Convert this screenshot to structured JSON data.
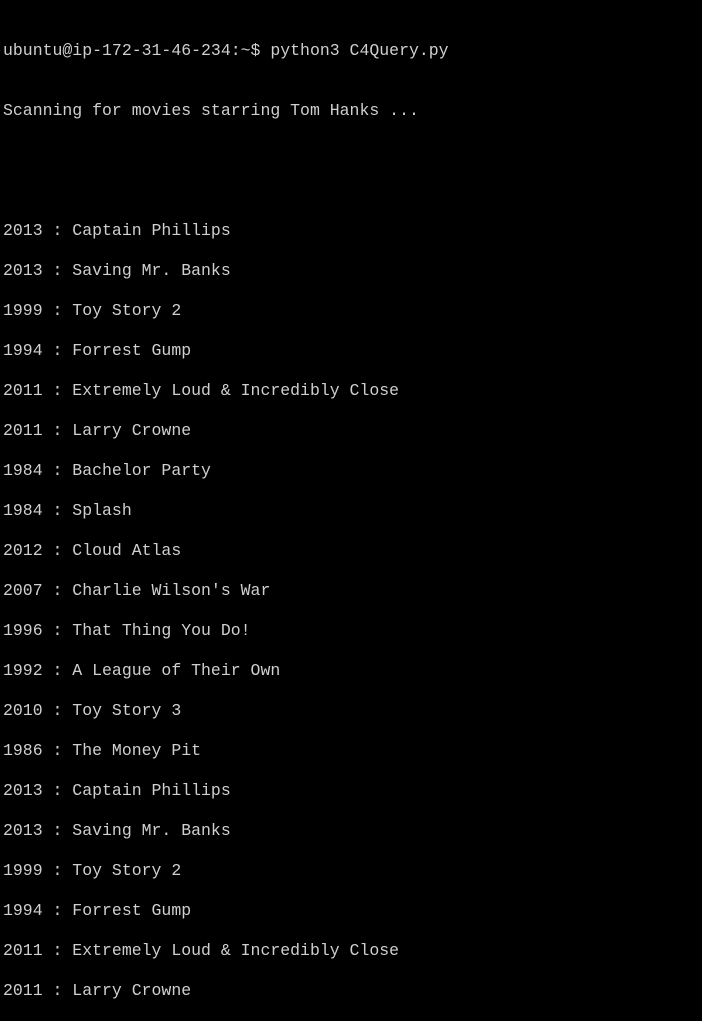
{
  "terminal": {
    "prompt": "ubuntu@ip-172-31-46-234:~$ python3 C4Query.py",
    "status": "Scanning for movies starring Tom Hanks ...",
    "results": [
      "2013 : Captain Phillips",
      "2013 : Saving Mr. Banks",
      "1999 : Toy Story 2",
      "1994 : Forrest Gump",
      "2011 : Extremely Loud & Incredibly Close",
      "2011 : Larry Crowne",
      "1984 : Bachelor Party",
      "1984 : Splash",
      "2012 : Cloud Atlas",
      "2007 : Charlie Wilson's War",
      "1996 : That Thing You Do!",
      "1992 : A League of Their Own",
      "2010 : Toy Story 3",
      "1986 : The Money Pit",
      "2013 : Captain Phillips",
      "2013 : Saving Mr. Banks",
      "1999 : Toy Story 2",
      "1994 : Forrest Gump",
      "2011 : Extremely Loud & Incredibly Close",
      "2011 : Larry Crowne"
    ]
  },
  "colors": {
    "background": "#000000",
    "text": "#cfcfcf"
  }
}
